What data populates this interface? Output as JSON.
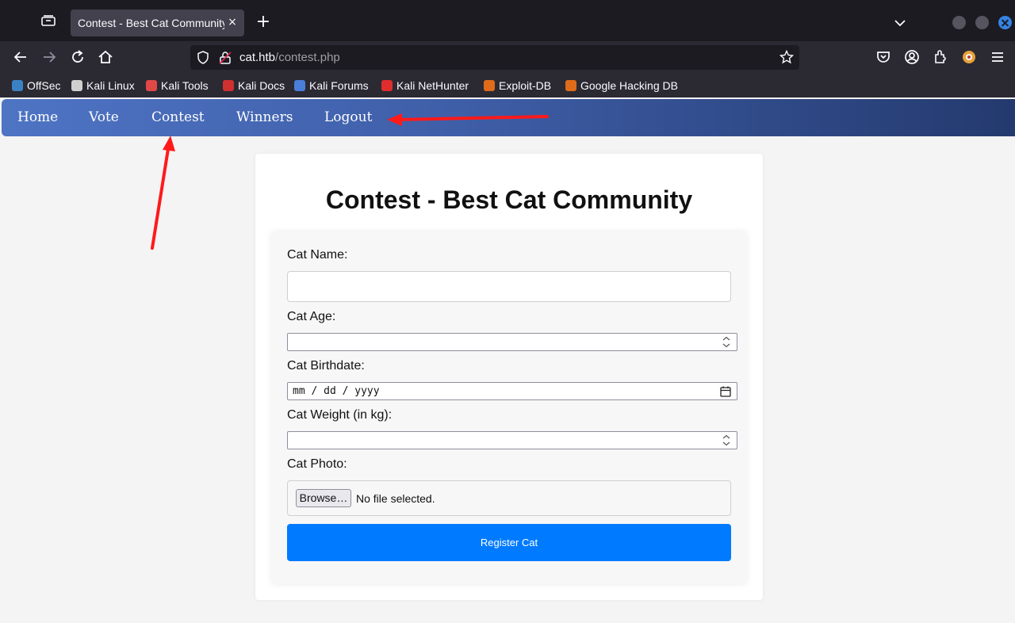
{
  "browser": {
    "tab_title": "Contest - Best Cat Community",
    "tab_close_glyph": "×",
    "new_tab_glyph": "+",
    "url_host": "cat.htb",
    "url_path": "/contest.php",
    "bookmarks": [
      {
        "label": "OffSec",
        "icon": "offsec-icon",
        "color": "#3b82c4"
      },
      {
        "label": "Kali Linux",
        "icon": "kali-dragon-icon",
        "color": "#d0d0d0"
      },
      {
        "label": "Kali Tools",
        "icon": "kali-tools-icon",
        "color": "#e04848"
      },
      {
        "label": "Kali Docs",
        "icon": "kali-docs-icon",
        "color": "#d03030"
      },
      {
        "label": "Kali Forums",
        "icon": "kali-forums-icon",
        "color": "#4a7fd8"
      },
      {
        "label": "Kali NetHunter",
        "icon": "nethunter-icon",
        "color": "#e02d2d"
      },
      {
        "label": "Exploit-DB",
        "icon": "exploit-db-icon",
        "color": "#e06b1a"
      },
      {
        "label": "Google Hacking DB",
        "icon": "ghdb-icon",
        "color": "#e06b1a"
      }
    ]
  },
  "site": {
    "nav": [
      "Home",
      "Vote",
      "Contest",
      "Winners",
      "Logout"
    ],
    "title": "Contest - Best Cat Community",
    "form": {
      "name_label": "Cat Name:",
      "age_label": "Cat Age:",
      "birthdate_label": "Cat Birthdate:",
      "birthdate_placeholder": "mm / dd / yyyy",
      "weight_label": "Cat Weight (in kg):",
      "photo_label": "Cat Photo:",
      "browse_label": "Browse…",
      "file_status": "No file selected.",
      "submit_label": "Register Cat"
    }
  },
  "colors": {
    "browser_tabbar": "#1c1b22",
    "browser_toolbar": "#2b2a33",
    "nav_gradient_start": "#4e74c4",
    "nav_gradient_end": "#243a6e",
    "submit_button": "#007bff",
    "annotation_arrow": "#ff1a1a"
  }
}
